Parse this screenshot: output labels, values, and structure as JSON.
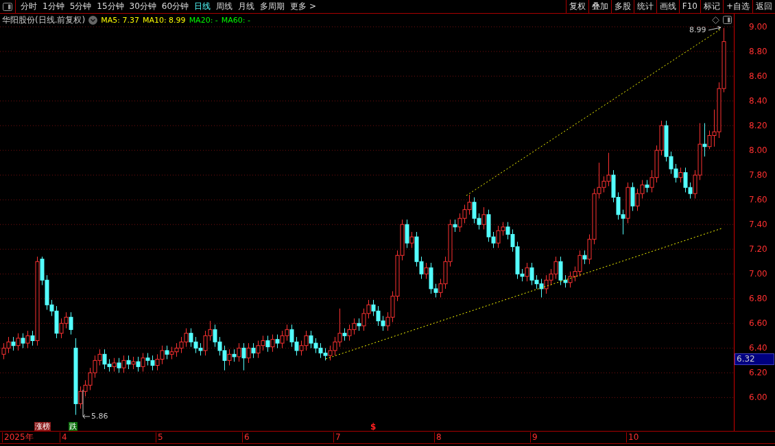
{
  "toolbar": {
    "periods": [
      {
        "label": "分时",
        "selected": false
      },
      {
        "label": "1分钟",
        "selected": false
      },
      {
        "label": "5分钟",
        "selected": false
      },
      {
        "label": "15分钟",
        "selected": false
      },
      {
        "label": "30分钟",
        "selected": false
      },
      {
        "label": "60分钟",
        "selected": false
      },
      {
        "label": "日线",
        "selected": true
      },
      {
        "label": "周线",
        "selected": false
      },
      {
        "label": "月线",
        "selected": false
      },
      {
        "label": "多周期",
        "selected": false
      },
      {
        "label": "更多 >",
        "selected": false
      }
    ],
    "actions": [
      "复权",
      "叠加",
      "多股",
      "统计",
      "画线",
      "F10",
      "标记",
      "+自选",
      "返回"
    ]
  },
  "legend": {
    "title": "华阳股份(日线.前复权)",
    "indicators": [
      {
        "label": "MA5: 7.37",
        "color": "#ffff00"
      },
      {
        "label": "MA10: 8.99",
        "color": "#ffff00"
      },
      {
        "label": "MA20: -",
        "color": "#00ff00"
      },
      {
        "label": "MA60: -",
        "color": "#00ff00"
      }
    ]
  },
  "chart": {
    "current_price": "6.32",
    "high_label": "8.99",
    "low_label": "5.86",
    "date_axis": [
      "2025年",
      "4",
      "5",
      "6",
      "7",
      "8",
      "9",
      "10"
    ],
    "markers": [
      {
        "label": "涨榜",
        "kind": "badge",
        "color": "#8b1a1a"
      },
      {
        "label": "跌",
        "kind": "badge",
        "color": "#0a6e0a"
      },
      {
        "label": "$",
        "kind": "symbol",
        "color": "#ff2020"
      }
    ],
    "chart_data": {
      "type": "candlestick",
      "ylim": [
        5.74,
        9.01
      ],
      "grid": true,
      "ohlc": [
        [
          6.35,
          6.44,
          6.31,
          6.4
        ],
        [
          6.4,
          6.49,
          6.36,
          6.45
        ],
        [
          6.45,
          6.49,
          6.38,
          6.42
        ],
        [
          6.42,
          6.52,
          6.38,
          6.48
        ],
        [
          6.48,
          6.52,
          6.4,
          6.44
        ],
        [
          6.44,
          6.54,
          6.4,
          6.5
        ],
        [
          6.5,
          6.54,
          6.42,
          6.46
        ],
        [
          6.46,
          7.14,
          6.42,
          7.1
        ],
        [
          7.12,
          7.14,
          6.91,
          6.95
        ],
        [
          6.95,
          6.99,
          6.71,
          6.75
        ],
        [
          6.75,
          6.79,
          6.66,
          6.7
        ],
        [
          6.7,
          6.74,
          6.48,
          6.52
        ],
        [
          6.52,
          6.64,
          6.48,
          6.6
        ],
        [
          6.6,
          6.69,
          6.56,
          6.65
        ],
        [
          6.65,
          6.69,
          6.51,
          6.55
        ],
        [
          6.4,
          6.48,
          5.86,
          5.95
        ],
        [
          5.95,
          6.09,
          5.91,
          6.05
        ],
        [
          6.05,
          6.14,
          6.01,
          6.1
        ],
        [
          6.1,
          6.24,
          6.06,
          6.2
        ],
        [
          6.2,
          6.34,
          6.16,
          6.3
        ],
        [
          6.3,
          6.39,
          6.26,
          6.35
        ],
        [
          6.35,
          6.39,
          6.23,
          6.27
        ],
        [
          6.27,
          6.31,
          6.21,
          6.25
        ],
        [
          6.25,
          6.32,
          6.21,
          6.28
        ],
        [
          6.28,
          6.32,
          6.2,
          6.24
        ],
        [
          6.24,
          6.34,
          6.2,
          6.3
        ],
        [
          6.3,
          6.34,
          6.23,
          6.27
        ],
        [
          6.27,
          6.33,
          6.23,
          6.29
        ],
        [
          6.29,
          6.33,
          6.21,
          6.25
        ],
        [
          6.25,
          6.36,
          6.21,
          6.32
        ],
        [
          6.32,
          6.36,
          6.26,
          6.3
        ],
        [
          6.3,
          6.34,
          6.22,
          6.26
        ],
        [
          6.26,
          6.35,
          6.22,
          6.31
        ],
        [
          6.31,
          6.42,
          6.27,
          6.38
        ],
        [
          6.38,
          6.42,
          6.31,
          6.35
        ],
        [
          6.35,
          6.41,
          6.31,
          6.37
        ],
        [
          6.37,
          6.44,
          6.33,
          6.4
        ],
        [
          6.4,
          6.49,
          6.36,
          6.45
        ],
        [
          6.45,
          6.56,
          6.41,
          6.52
        ],
        [
          6.52,
          6.56,
          6.41,
          6.45
        ],
        [
          6.45,
          6.49,
          6.36,
          6.4
        ],
        [
          6.4,
          6.44,
          6.34,
          6.38
        ],
        [
          6.38,
          6.54,
          6.34,
          6.5
        ],
        [
          6.5,
          6.62,
          6.46,
          6.55
        ],
        [
          6.55,
          6.59,
          6.41,
          6.45
        ],
        [
          6.45,
          6.49,
          6.34,
          6.38
        ],
        [
          6.38,
          6.42,
          6.22,
          6.3
        ],
        [
          6.3,
          6.39,
          6.26,
          6.35
        ],
        [
          6.35,
          6.39,
          6.29,
          6.33
        ],
        [
          6.33,
          6.44,
          6.29,
          6.4
        ],
        [
          6.4,
          6.44,
          6.22,
          6.32
        ],
        [
          6.32,
          6.44,
          6.28,
          6.4
        ],
        [
          6.4,
          6.44,
          6.32,
          6.36
        ],
        [
          6.36,
          6.46,
          6.32,
          6.42
        ],
        [
          6.42,
          6.5,
          6.38,
          6.46
        ],
        [
          6.46,
          6.5,
          6.37,
          6.41
        ],
        [
          6.41,
          6.51,
          6.37,
          6.47
        ],
        [
          6.47,
          6.51,
          6.4,
          6.44
        ],
        [
          6.44,
          6.54,
          6.4,
          6.5
        ],
        [
          6.5,
          6.59,
          6.46,
          6.55
        ],
        [
          6.55,
          6.59,
          6.41,
          6.45
        ],
        [
          6.45,
          6.49,
          6.34,
          6.38
        ],
        [
          6.38,
          6.46,
          6.34,
          6.42
        ],
        [
          6.42,
          6.54,
          6.38,
          6.5
        ],
        [
          6.5,
          6.54,
          6.4,
          6.44
        ],
        [
          6.44,
          6.48,
          6.36,
          6.4
        ],
        [
          6.4,
          6.44,
          6.32,
          6.36
        ],
        [
          6.36,
          6.4,
          6.3,
          6.34
        ],
        [
          6.34,
          6.42,
          6.3,
          6.38
        ],
        [
          6.38,
          6.49,
          6.34,
          6.45
        ],
        [
          6.45,
          6.72,
          6.41,
          6.52
        ],
        [
          6.52,
          6.56,
          6.46,
          6.5
        ],
        [
          6.5,
          6.59,
          6.46,
          6.55
        ],
        [
          6.55,
          6.64,
          6.51,
          6.6
        ],
        [
          6.6,
          6.64,
          6.54,
          6.58
        ],
        [
          6.58,
          6.72,
          6.54,
          6.68
        ],
        [
          6.68,
          6.79,
          6.64,
          6.75
        ],
        [
          6.75,
          6.79,
          6.66,
          6.7
        ],
        [
          6.7,
          6.74,
          6.58,
          6.62
        ],
        [
          6.62,
          6.66,
          6.54,
          6.58
        ],
        [
          6.58,
          6.69,
          6.54,
          6.65
        ],
        [
          6.65,
          6.86,
          6.61,
          6.82
        ],
        [
          6.82,
          7.19,
          6.78,
          7.15
        ],
        [
          7.15,
          7.44,
          7.11,
          7.4
        ],
        [
          7.4,
          7.44,
          7.21,
          7.25
        ],
        [
          7.25,
          7.34,
          7.21,
          7.3
        ],
        [
          7.3,
          7.34,
          7.06,
          7.1
        ],
        [
          7.1,
          7.14,
          6.96,
          7.0
        ],
        [
          7.0,
          7.09,
          6.96,
          7.05
        ],
        [
          7.05,
          7.09,
          6.84,
          6.88
        ],
        [
          6.88,
          6.92,
          6.81,
          6.85
        ],
        [
          6.85,
          6.96,
          6.81,
          6.92
        ],
        [
          6.92,
          7.14,
          6.88,
          7.1
        ],
        [
          7.1,
          7.44,
          7.06,
          7.4
        ],
        [
          7.4,
          7.44,
          7.34,
          7.38
        ],
        [
          7.38,
          7.49,
          7.34,
          7.45
        ],
        [
          7.45,
          7.56,
          7.41,
          7.52
        ],
        [
          7.52,
          7.64,
          7.48,
          7.58
        ],
        [
          7.58,
          7.62,
          7.41,
          7.45
        ],
        [
          7.45,
          7.49,
          7.36,
          7.4
        ],
        [
          7.4,
          7.54,
          7.36,
          7.48
        ],
        [
          7.48,
          7.52,
          7.26,
          7.3
        ],
        [
          7.3,
          7.34,
          7.21,
          7.25
        ],
        [
          7.25,
          7.39,
          7.21,
          7.35
        ],
        [
          7.35,
          7.42,
          7.31,
          7.38
        ],
        [
          7.38,
          7.42,
          7.28,
          7.32
        ],
        [
          7.32,
          7.36,
          7.18,
          7.22
        ],
        [
          7.22,
          7.26,
          6.96,
          7.0
        ],
        [
          7.0,
          7.04,
          6.94,
          6.98
        ],
        [
          6.98,
          7.09,
          6.94,
          7.05
        ],
        [
          7.05,
          7.09,
          6.91,
          6.95
        ],
        [
          6.95,
          6.99,
          6.88,
          6.92
        ],
        [
          6.92,
          6.96,
          6.81,
          6.88
        ],
        [
          6.88,
          6.99,
          6.84,
          6.95
        ],
        [
          6.95,
          7.04,
          6.91,
          7.0
        ],
        [
          7.0,
          7.14,
          6.96,
          7.1
        ],
        [
          7.1,
          7.14,
          6.91,
          6.95
        ],
        [
          6.95,
          6.99,
          6.89,
          6.93
        ],
        [
          6.93,
          7.02,
          6.89,
          6.98
        ],
        [
          6.98,
          7.06,
          6.94,
          7.02
        ],
        [
          7.02,
          7.19,
          6.98,
          7.15
        ],
        [
          7.15,
          7.19,
          7.08,
          7.12
        ],
        [
          7.12,
          7.32,
          7.08,
          7.28
        ],
        [
          7.28,
          7.69,
          7.24,
          7.65
        ],
        [
          7.65,
          7.9,
          7.61,
          7.7
        ],
        [
          7.7,
          7.79,
          7.66,
          7.75
        ],
        [
          7.75,
          7.98,
          7.71,
          7.8
        ],
        [
          7.8,
          7.84,
          7.58,
          7.62
        ],
        [
          7.62,
          7.66,
          7.44,
          7.48
        ],
        [
          7.48,
          7.52,
          7.32,
          7.45
        ],
        [
          7.45,
          7.74,
          7.41,
          7.7
        ],
        [
          7.7,
          7.74,
          7.51,
          7.55
        ],
        [
          7.55,
          7.69,
          7.51,
          7.65
        ],
        [
          7.65,
          7.76,
          7.61,
          7.72
        ],
        [
          7.72,
          7.76,
          7.66,
          7.7
        ],
        [
          7.7,
          7.84,
          7.66,
          7.78
        ],
        [
          7.78,
          8.04,
          7.74,
          8.0
        ],
        [
          8.0,
          8.24,
          7.96,
          8.2
        ],
        [
          8.2,
          8.24,
          7.91,
          7.95
        ],
        [
          7.95,
          7.99,
          7.81,
          7.85
        ],
        [
          7.85,
          7.89,
          7.74,
          7.78
        ],
        [
          7.78,
          7.86,
          7.74,
          7.82
        ],
        [
          7.82,
          7.86,
          7.66,
          7.7
        ],
        [
          7.7,
          7.74,
          7.61,
          7.65
        ],
        [
          7.65,
          7.84,
          7.61,
          7.8
        ],
        [
          7.8,
          8.22,
          7.76,
          8.05
        ],
        [
          8.05,
          8.22,
          7.95,
          8.03
        ],
        [
          8.03,
          8.16,
          8.01,
          8.12
        ],
        [
          8.12,
          8.33,
          8.03,
          8.15
        ],
        [
          8.15,
          8.55,
          8.1,
          8.5
        ],
        [
          8.5,
          8.99,
          8.47,
          8.88
        ]
      ],
      "yticks": [
        {
          "value": 9,
          "label": "9.00"
        },
        {
          "value": 8.8,
          "label": "8.80"
        },
        {
          "value": 8.6,
          "label": "8.60"
        },
        {
          "value": 8.4,
          "label": "8.40"
        },
        {
          "value": 8.2,
          "label": "8.20"
        },
        {
          "value": 8,
          "label": "8.00"
        },
        {
          "value": 7.8,
          "label": "7.80"
        },
        {
          "value": 7.6,
          "label": "7.60"
        },
        {
          "value": 7.4,
          "label": "7.40"
        },
        {
          "value": 7.2,
          "label": "7.20"
        },
        {
          "value": 7,
          "label": "7.00"
        },
        {
          "value": 6.8,
          "label": "6.80"
        },
        {
          "value": 6.6,
          "label": "6.60"
        },
        {
          "value": 6.4,
          "label": "6.40"
        },
        {
          "value": 6.2,
          "label": "6.20"
        },
        {
          "value": 6,
          "label": "6.00"
        }
      ]
    }
  }
}
